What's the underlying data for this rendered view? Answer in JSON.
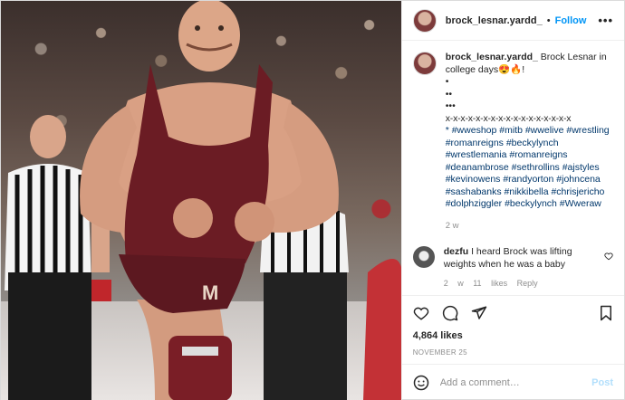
{
  "post": {
    "username": "brock_lesnar.yardd_",
    "follow_label": "Follow",
    "separator": "•",
    "more_label": "•••",
    "photo_icon": "wrestler-photo"
  },
  "caption": {
    "username": "brock_lesnar.yardd_",
    "text": "Brock Lesnar in college days😍🔥!",
    "lines": [
      "•",
      "••",
      "•••",
      "x-x-x-x-x-x-x-x-x-x-x-x-x-x-x-x-x"
    ],
    "hashtags": "* #wweshop #mitb #wwelive #wrestling #romanreigns #beckylynch #wrestlemania #romanreigns #deanambrose #sethrollins #ajstyles #kevinowens #randyorton #johncena #sashabanks #nikkibella #chrisjericho #dolphziggler #beckylynch #Wweraw",
    "time": "2 w"
  },
  "reply": {
    "username": "dezfu",
    "text": "I heard Brock was lifting weights when he was a baby",
    "meta": "2 w  11 likes  Reply"
  },
  "stats": {
    "likes": "4,864 likes",
    "date": "NOVEMBER 25"
  },
  "comment_box": {
    "placeholder": "Add a comment…",
    "post_label": "Post"
  },
  "colors": {
    "accent": "#0095f6",
    "link": "#00376b",
    "post_disabled": "#b2dffc",
    "singlet": "#6b1c24"
  },
  "icons": [
    "heart-icon",
    "comment-icon",
    "share-icon",
    "bookmark-icon",
    "emoji-icon",
    "more-icon"
  ]
}
